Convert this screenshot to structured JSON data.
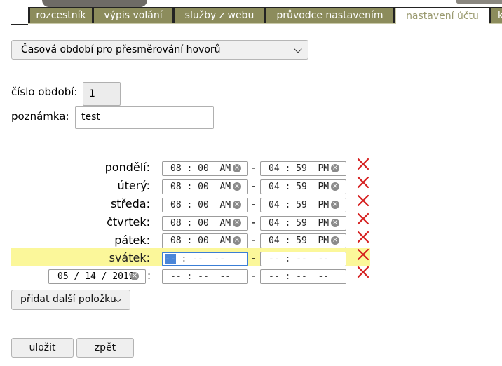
{
  "tabs": [
    "rozcestník",
    "výpis volání",
    "služby z webu",
    "průvodce nastavením",
    "nastavení účtu",
    "k"
  ],
  "active_tab": "nastavení účtu",
  "section_select": "Časová období pro přesměrování hovorů",
  "period_number": {
    "label": "číslo období:",
    "value": "1"
  },
  "note": {
    "label": "poznámka:",
    "value": "test"
  },
  "schedule": [
    {
      "day": "pondělí:",
      "from": "08 : 00  AM",
      "to": "04 : 59  PM"
    },
    {
      "day": "úterý:",
      "from": "08 : 00  AM",
      "to": "04 : 59  PM"
    },
    {
      "day": "středa:",
      "from": "08 : 00  AM",
      "to": "04 : 59  PM"
    },
    {
      "day": "čtvrtek:",
      "from": "08 : 00  AM",
      "to": "04 : 59  PM"
    },
    {
      "day": "pátek:",
      "from": "08 : 00  AM",
      "to": "04 : 59  PM"
    },
    {
      "day": "svátek:",
      "from_selected": "--",
      "from_rest": " : --  --",
      "to": "-- : --  --",
      "highlighted": true
    }
  ],
  "custom_date": {
    "value": "05 / 14 / 2019",
    "colon": ":",
    "from": "-- : --  --",
    "to": "-- : --  --"
  },
  "separator": "-",
  "clear_glyph": "×",
  "add_button": "přidat další položku",
  "save_button": "uložit",
  "back_button": "zpět",
  "colors": {
    "tab_bg": "#8c8c5c",
    "tab_text_active": "#9a9a70",
    "highlight_row": "#fbf79a",
    "delete_icon": "#d62020",
    "focus_border": "#3b7ed6"
  }
}
